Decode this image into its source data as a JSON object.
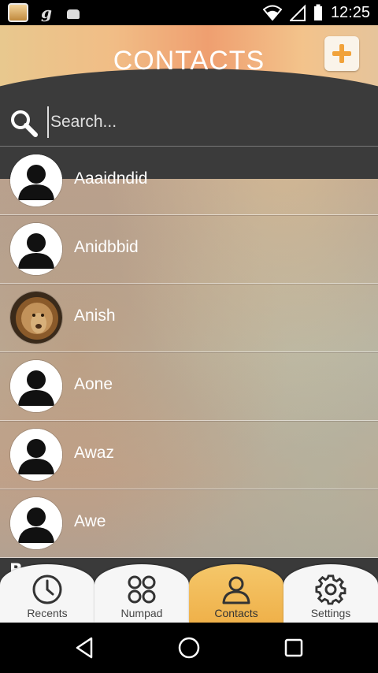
{
  "status_bar": {
    "time": "12:25",
    "left_icons": [
      "app-notification-icon",
      "g-notification-icon",
      "android-notification-icon"
    ],
    "right_icons": [
      "wifi-icon",
      "cellular-icon",
      "battery-icon"
    ]
  },
  "header": {
    "title": "CONTACTS",
    "add_icon": "plus-icon"
  },
  "search": {
    "placeholder": "Search...",
    "value": ""
  },
  "contacts": [
    {
      "name": "Aaaidndid",
      "avatar": "default"
    },
    {
      "name": "Anidbbid",
      "avatar": "default"
    },
    {
      "name": "Anish",
      "avatar": "photo-lion"
    },
    {
      "name": "Aone",
      "avatar": "default"
    },
    {
      "name": "Awaz",
      "avatar": "default"
    },
    {
      "name": "Awe",
      "avatar": "default"
    }
  ],
  "section_header": "B",
  "bottom_nav": {
    "tabs": [
      {
        "label": "Recents",
        "icon": "clock-icon",
        "active": false
      },
      {
        "label": "Numpad",
        "icon": "numpad-icon",
        "active": false
      },
      {
        "label": "Contacts",
        "icon": "person-icon",
        "active": true
      },
      {
        "label": "Settings",
        "icon": "gear-icon",
        "active": false
      }
    ]
  },
  "colors": {
    "accent": "#efb14a",
    "header_dark": "#3b3b3b",
    "plus": "#f1a23a"
  }
}
